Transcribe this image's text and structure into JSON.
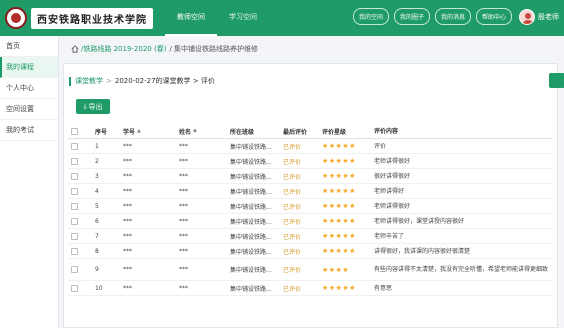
{
  "header": {
    "logo_text": "西安铁路职业技术学院",
    "nav": [
      "教师空间",
      "学习空间"
    ],
    "actions": [
      "我的空间",
      "我的圈子",
      "我的消息",
      "帮助中心"
    ],
    "username": "殷老师"
  },
  "sidebar": {
    "items": [
      {
        "label": "首页",
        "active": false
      },
      {
        "label": "我的课程",
        "active": true
      },
      {
        "label": "个人中心",
        "active": false
      },
      {
        "label": "空间设置",
        "active": false
      },
      {
        "label": "我的考试",
        "active": false
      }
    ]
  },
  "breadcrumb": {
    "home": "",
    "course": "/铁路线路 2019-2020 (春)",
    "current": "/ 集中铺设铁路线路养护维修"
  },
  "card": {
    "subcrumb_link": "课堂教学",
    "subcrumb_current": "2020-02-27的课堂教学 > 评价",
    "export_label": "导出"
  },
  "table": {
    "headers": {
      "no": "序号",
      "sid": "学号",
      "name": "姓名",
      "class": "所在班级",
      "last": "最后评价",
      "stars": "评价星级",
      "content": "评价内容"
    },
    "rows": [
      {
        "no": "1",
        "sid": "***",
        "name": "***",
        "class": "集中铺设铁路...",
        "last": "已评价",
        "stars": "★★★★★",
        "content": "评价",
        "tall": false
      },
      {
        "no": "2",
        "sid": "***",
        "name": "***",
        "class": "集中铺设铁路...",
        "last": "已评价",
        "stars": "★★★★★",
        "content": "老师讲得很好",
        "tall": false
      },
      {
        "no": "3",
        "sid": "***",
        "name": "***",
        "class": "集中铺设铁路...",
        "last": "已评价",
        "stars": "★★★★★",
        "content": "很好讲得很好",
        "tall": false
      },
      {
        "no": "4",
        "sid": "***",
        "name": "***",
        "class": "集中铺设铁路...",
        "last": "已评价",
        "stars": "★★★★★",
        "content": "老师讲得好",
        "tall": false
      },
      {
        "no": "5",
        "sid": "***",
        "name": "***",
        "class": "集中铺设铁路...",
        "last": "已评价",
        "stars": "★★★★★",
        "content": "老师讲得很好",
        "tall": false
      },
      {
        "no": "6",
        "sid": "***",
        "name": "***",
        "class": "集中铺设铁路...",
        "last": "已评价",
        "stars": "★★★★★",
        "content": "老师讲得很好，课堂讲授内容很好",
        "tall": false
      },
      {
        "no": "7",
        "sid": "***",
        "name": "***",
        "class": "集中铺设铁路...",
        "last": "已评价",
        "stars": "★★★★★",
        "content": "老师辛苦了",
        "tall": false
      },
      {
        "no": "8",
        "sid": "***",
        "name": "***",
        "class": "集中铺设铁路...",
        "last": "已评价",
        "stars": "★★★★★",
        "content": "讲得很好，我讲课的内容很好很清楚",
        "tall": false
      },
      {
        "no": "9",
        "sid": "***",
        "name": "***",
        "class": "集中铺设铁路...",
        "last": "已评价",
        "stars": "★★★★",
        "content": "有些内容讲得不太清楚，我没有完全听懂，希望老师能讲得更细致",
        "tall": true
      },
      {
        "no": "10",
        "sid": "***",
        "name": "***",
        "class": "集中铺设铁路...",
        "last": "已评价",
        "stars": "★★★★★",
        "content": "有意思",
        "tall": false
      }
    ]
  },
  "colors": {
    "brand": "#1e9b67",
    "star": "#f5a623"
  }
}
